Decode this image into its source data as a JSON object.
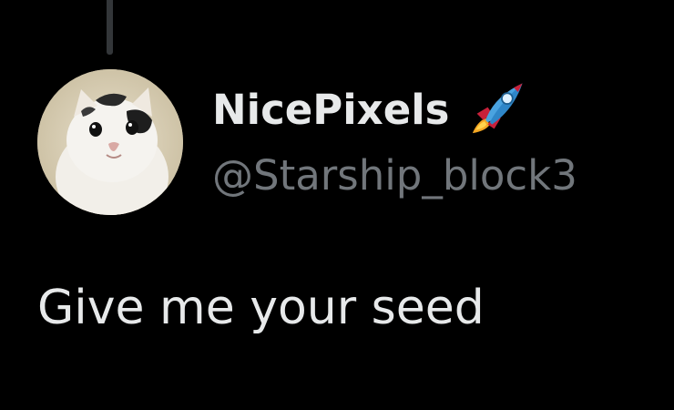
{
  "author": {
    "display_name": "NicePixels",
    "handle": "@Starship_block3",
    "badge_icon": "rocket-icon",
    "avatar_icon": "cat-avatar"
  },
  "tweet": {
    "text": "Give me your seed"
  },
  "colors": {
    "background": "#000000",
    "primary_text": "#e7e9ea",
    "secondary_text": "#71767b",
    "thread_line": "#333639"
  }
}
